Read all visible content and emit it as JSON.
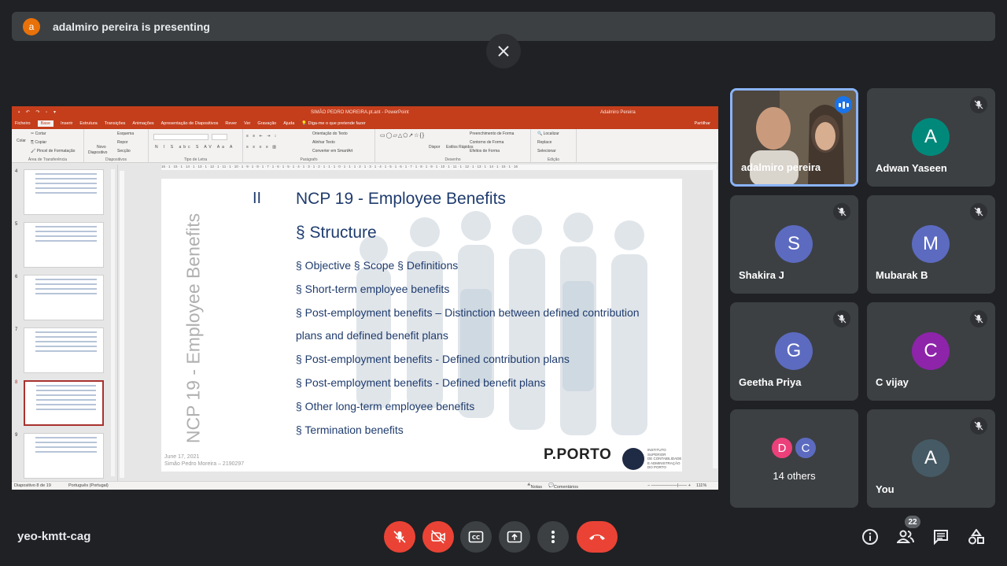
{
  "banner": {
    "avatar_letter": "a",
    "text": "adalmiro pereira is presenting"
  },
  "powerpoint": {
    "title": "SIMÃO PEDRO MOREIRA.pt.ant - PowerPoint",
    "user": "Adalmiro Pereira",
    "tabs": [
      "Ficheiro",
      "Base",
      "Inserir",
      "Estrutura",
      "Transições",
      "Animações",
      "Apresentação de Diapositivos",
      "Rever",
      "Ver",
      "Gravação",
      "Ajuda"
    ],
    "active_tab": "Base",
    "tell_me": "Diga-me o que pretende fazer",
    "share": "Partilhar",
    "ribbon": {
      "colar": "Colar",
      "cortar": "Cortar",
      "copiar": "Copiar",
      "pincel": "Pincel de Formatação",
      "area": "Área de Transferência",
      "novo": "Novo",
      "diapositivo": "Diapositivo",
      "esquema": "Esquema",
      "repor": "Repor",
      "seccao": "Secção",
      "diapositivos": "Diapositivos",
      "tipo_letra": "Tipo de Letra",
      "orientacao": "Orientação do Texto",
      "alinhar": "Alinhar Texto",
      "converter": "Converter em SmartArt",
      "paragrafo": "Parágrafo",
      "dispor": "Dispor",
      "estilos": "Estilos Rápidos",
      "preenchimento": "Preenchimento de Forma",
      "contorno": "Contorno de Forma",
      "efeitos": "Efeitos de Forma",
      "desenho": "Desenho",
      "localizar": "Localizar",
      "substituir": "Replace",
      "selecionar": "Selecionar",
      "edicao": "Edição"
    },
    "ruler_text": "16 · 1 · 15 · 1 · 14 · 1 · 13 · 1 · 12 · 1 · 11 · 1 · 10 · 1 · 9 · 1 · 8 · 1 · 7 · 1 · 6 · 1 · 5 · 1 · 4 · 1 · 3 · 1 · 2 · 1 · 1 · 1 · 0 · 1 · 1 · 1 · 2 · 1 · 3 · 1 · 4 · 1 · 5 · 1 · 6 · 1 · 7 · 1 · 8 · 1 · 9 · 1 · 10 · 1 · 11 · 1 · 12 · 1 · 13 · 1 · 14 · 1 · 15 · 1 · 16",
    "thumbnails": [
      "4",
      "5",
      "6",
      "7",
      "8",
      "9"
    ],
    "slide": {
      "number": "II",
      "title": "NCP 19 - Employee Benefits",
      "subtitle": "§ Structure",
      "vertical_title": "NCP 19 - Employee Benefits",
      "bullets": [
        "§ Objective § Scope § Definitions",
        "§ Short-term employee benefits",
        "§ Post-employment benefits – Distinction between defined contribution",
        "plans and defined benefit plans",
        "§ Post-employment benefits - Defined contribution plans",
        "§ Post-employment benefits - Defined benefit plans",
        "§ Other long-term employee benefits",
        "§ Termination benefits"
      ],
      "footer_date": "June 17, 2021",
      "footer_author": "Simão Pedro Moreira – 2190297",
      "logo": "P.PORTO",
      "institute": [
        "INSTITUTO",
        "SUPERIOR",
        "DE CONTABILIDADE",
        "E ADMINISTRAÇÃO",
        "DO PORTO"
      ]
    },
    "status": {
      "slide_of": "Diapositivo 8 de 19",
      "language": "Português (Portugal)",
      "notes": "Notas",
      "comments": "Comentários",
      "zoom": "111%"
    }
  },
  "participants": [
    {
      "name": "adalmiro pereira",
      "type": "video",
      "speaking": true
    },
    {
      "name": "Adwan Yaseen",
      "letter": "A",
      "color": "#00897b",
      "muted": true
    },
    {
      "name": "Shakira J",
      "letter": "S",
      "color": "#5c6bc0",
      "muted": true
    },
    {
      "name": "Mubarak B",
      "letter": "M",
      "color": "#5c6bc0",
      "muted": true
    },
    {
      "name": "Geetha Priya",
      "letter": "G",
      "color": "#5c6bc0",
      "muted": true
    },
    {
      "name": "C vijay",
      "letter": "C",
      "color": "#8e24aa",
      "muted": true
    },
    {
      "others": "14 others",
      "letters": [
        "D",
        "C"
      ],
      "colors": [
        "#ec407a",
        "#5c6bc0"
      ]
    },
    {
      "name": "You",
      "letter": "A",
      "color": "#455a64",
      "muted": true
    }
  ],
  "meeting": {
    "code": "yeo-kmtt-cag",
    "people_count": "22"
  },
  "controls": [
    "mic-off",
    "camera-off",
    "captions",
    "present",
    "more",
    "leave"
  ]
}
